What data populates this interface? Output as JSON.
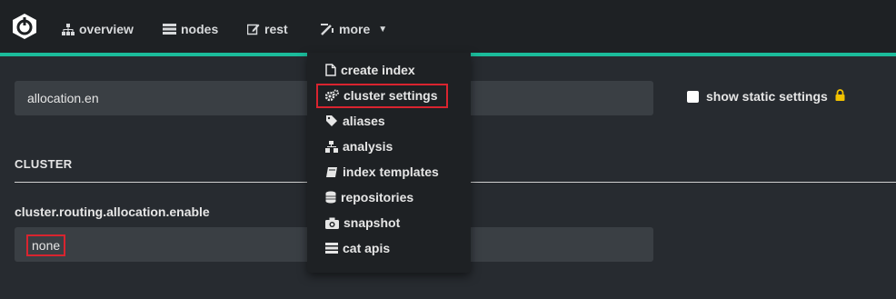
{
  "nav": {
    "overview": "overview",
    "nodes": "nodes",
    "rest": "rest",
    "more": "more"
  },
  "more_menu": {
    "items": [
      {
        "label": "create index",
        "icon": "file-icon"
      },
      {
        "label": "cluster settings",
        "icon": "cogs-icon",
        "highlighted": true
      },
      {
        "label": "aliases",
        "icon": "tag-icon"
      },
      {
        "label": "analysis",
        "icon": "sitemap-icon"
      },
      {
        "label": "index templates",
        "icon": "book-icon"
      },
      {
        "label": "repositories",
        "icon": "database-icon"
      },
      {
        "label": "snapshot",
        "icon": "camera-icon"
      },
      {
        "label": "cat apis",
        "icon": "list-icon"
      }
    ]
  },
  "filter": {
    "value": "allocation.en"
  },
  "static_settings": {
    "label": "show static settings",
    "checked": false
  },
  "section": {
    "title": "CLUSTER"
  },
  "setting": {
    "name": "cluster.routing.allocation.enable",
    "value": "none"
  },
  "colors": {
    "accent": "#1bbc9b",
    "highlight": "#d9242f",
    "lock": "#f2c200"
  }
}
